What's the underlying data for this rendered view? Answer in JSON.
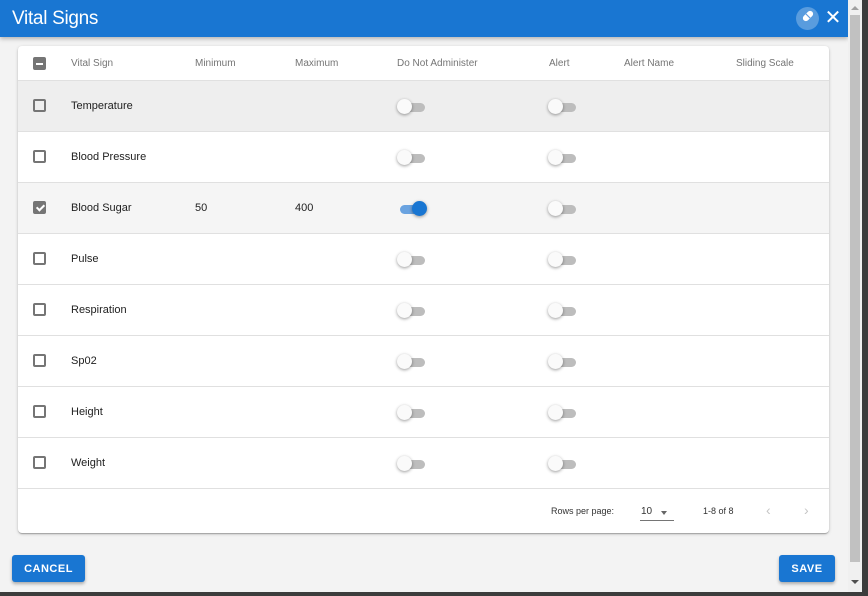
{
  "dialog": {
    "title": "Vital Signs",
    "accent_color": "#1976d2",
    "header_icons": [
      "pill-icon",
      "close-icon"
    ],
    "close_glyph": "✕"
  },
  "table": {
    "columns": [
      "Vital Sign",
      "Minimum",
      "Maximum",
      "Do Not Administer",
      "Alert",
      "Alert Name",
      "Sliding Scale"
    ],
    "header_checkbox_state": "indeterminate",
    "rows": [
      {
        "name": "Temperature",
        "minimum": "",
        "maximum": "",
        "checked": false,
        "do_not_administer": false,
        "alert": false,
        "alert_name": "",
        "sliding_scale": ""
      },
      {
        "name": "Blood Pressure",
        "minimum": "",
        "maximum": "",
        "checked": false,
        "do_not_administer": false,
        "alert": false,
        "alert_name": "",
        "sliding_scale": ""
      },
      {
        "name": "Blood Sugar",
        "minimum": "50",
        "maximum": "400",
        "checked": true,
        "do_not_administer": true,
        "alert": false,
        "alert_name": "",
        "sliding_scale": ""
      },
      {
        "name": "Pulse",
        "minimum": "",
        "maximum": "",
        "checked": false,
        "do_not_administer": false,
        "alert": false,
        "alert_name": "",
        "sliding_scale": ""
      },
      {
        "name": "Respiration",
        "minimum": "",
        "maximum": "",
        "checked": false,
        "do_not_administer": false,
        "alert": false,
        "alert_name": "",
        "sliding_scale": ""
      },
      {
        "name": "Sp02",
        "minimum": "",
        "maximum": "",
        "checked": false,
        "do_not_administer": false,
        "alert": false,
        "alert_name": "",
        "sliding_scale": ""
      },
      {
        "name": "Height",
        "minimum": "",
        "maximum": "",
        "checked": false,
        "do_not_administer": false,
        "alert": false,
        "alert_name": "",
        "sliding_scale": ""
      },
      {
        "name": "Weight",
        "minimum": "",
        "maximum": "",
        "checked": false,
        "do_not_administer": false,
        "alert": false,
        "alert_name": "",
        "sliding_scale": ""
      }
    ]
  },
  "pagination": {
    "rows_per_page_label": "Rows per page:",
    "rows_per_page": "10",
    "range": "1-8 of 8",
    "prev_glyph": "‹",
    "next_glyph": "›"
  },
  "actions": {
    "cancel_label": "CANCEL",
    "save_label": "SAVE"
  }
}
